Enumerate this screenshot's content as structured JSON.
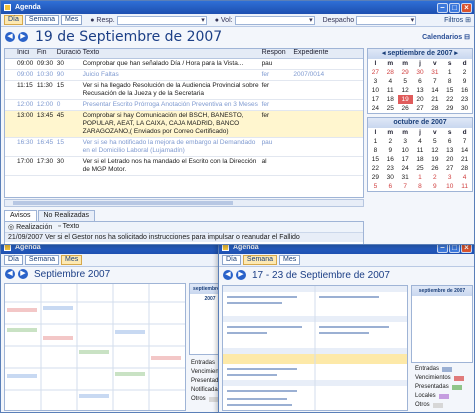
{
  "main": {
    "title": "Agenda",
    "view_buttons": [
      "Día",
      "Semana",
      "Mes"
    ],
    "resp_label": "Resp.",
    "vol_label": "Vol:",
    "despacho_label": "Despacho",
    "filters_label": "Filtros",
    "date_title": "19 de Septiembre de 2007",
    "calendars_label": "Calendarios",
    "columns": [
      "Inici",
      "Fin",
      "Duración",
      "Texto",
      "Respon",
      "Expediente"
    ],
    "rows": [
      {
        "start": "09:00",
        "end": "09:30",
        "dur": "30",
        "text": "Comprobar que han señalado Día / Hora para la Vista...",
        "resp": "pau",
        "exp": "",
        "style": "plain"
      },
      {
        "start": "09:00",
        "end": "10:30",
        "dur": "90",
        "text": "Juicio Faltas",
        "resp": "fer",
        "exp": "2007/0014",
        "style": "faded"
      },
      {
        "start": "11:15",
        "end": "11:30",
        "dur": "15",
        "text": "Ver si ha llegado Resolución de la Audiencia Provincial sobre Recusación de la Jueza y de la Secretaria",
        "resp": "fer",
        "exp": "",
        "style": "plain"
      },
      {
        "start": "12:00",
        "end": "12:00",
        "dur": "0",
        "text": "Presentar Escrito Prórroga Anotación Preventiva en 3 Meses",
        "resp": "fer",
        "exp": "",
        "style": "faded"
      },
      {
        "start": "13:00",
        "end": "13:45",
        "dur": "45",
        "text": "Comprobar si hay Comunicación del BSCH, BANESTO, POPULAR, AEAT, LA CAIXA, CAJA MADRID, BANCO ZARAGOZANO,( Enviados por Correo Certificado)",
        "resp": "fer",
        "exp": "",
        "style": "highlight"
      },
      {
        "start": "16:30",
        "end": "16:45",
        "dur": "15",
        "text": "Ver si se ha notificado la mejora de embargo al Demandado en el Domicilio Laboral (Lujamadín)",
        "resp": "pau",
        "exp": "",
        "style": "faded"
      },
      {
        "start": "17:00",
        "end": "17:30",
        "dur": "30",
        "text": "Ver si el Letrado nos ha mandado el Escrito con la Dirección de MGP Motor.",
        "resp": "al",
        "exp": "",
        "style": "plain"
      }
    ],
    "tabs": [
      "Avisos",
      "No Realizadas"
    ],
    "detail_header": [
      "Realización",
      "Texto"
    ],
    "detail_row": "21/09/2007  Ver si el Gestor nos ha solicitado instrucciones para impulsar o reanudar el Fallido",
    "mini_cal_1": {
      "header": "septiembre de 2007",
      "days": [
        "l",
        "m",
        "m",
        "j",
        "v",
        "s",
        "d"
      ],
      "weeks": [
        [
          "27",
          "28",
          "29",
          "30",
          "31",
          "1",
          "2"
        ],
        [
          "3",
          "4",
          "5",
          "6",
          "7",
          "8",
          "9"
        ],
        [
          "10",
          "11",
          "12",
          "13",
          "14",
          "15",
          "16"
        ],
        [
          "17",
          "18",
          "19",
          "20",
          "21",
          "22",
          "23"
        ],
        [
          "24",
          "25",
          "26",
          "27",
          "28",
          "29",
          "30"
        ]
      ]
    },
    "mini_cal_2": {
      "header": "octubre de 2007",
      "days": [
        "l",
        "m",
        "m",
        "j",
        "v",
        "s",
        "d"
      ],
      "weeks": [
        [
          "1",
          "2",
          "3",
          "4",
          "5",
          "6",
          "7"
        ],
        [
          "8",
          "9",
          "10",
          "11",
          "12",
          "13",
          "14"
        ],
        [
          "15",
          "16",
          "17",
          "18",
          "19",
          "20",
          "21"
        ],
        [
          "22",
          "23",
          "24",
          "25",
          "26",
          "27",
          "28"
        ],
        [
          "29",
          "30",
          "31",
          "1",
          "2",
          "3",
          "4"
        ],
        [
          "5",
          "6",
          "7",
          "8",
          "9",
          "10",
          "11"
        ]
      ]
    }
  },
  "thumb_left": {
    "title": "Agenda",
    "date_title": "Septiembre 2007",
    "legend": [
      "Entradas",
      "Vencimientos",
      "Presentadas",
      "Notificadas",
      "Otros"
    ]
  },
  "thumb_right": {
    "title": "Agenda",
    "date_title": "17 - 23 de Septiembre de 2007",
    "legend": [
      "Entradas",
      "Vencimientos",
      "Presentadas",
      "Locales",
      "Otros"
    ]
  },
  "colors": {
    "titlebar": "#2f6fd6",
    "accent": "#1c3f86",
    "highlight_row": "#fff6cf",
    "today": "#e05b5b"
  }
}
